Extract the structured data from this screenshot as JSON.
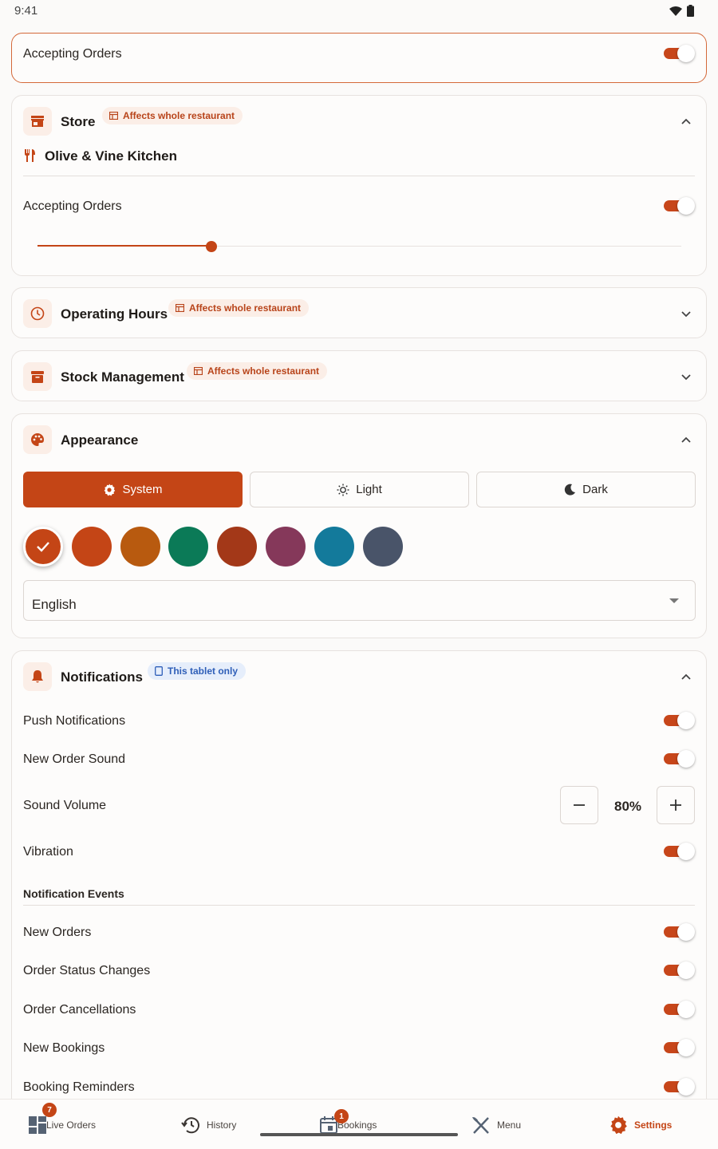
{
  "status_bar": {
    "time": "9:41",
    "wifi_icon": "wifi-icon",
    "battery_icon": "battery-icon"
  },
  "top_toggle": {
    "label": "Accepting Orders",
    "on": true
  },
  "store": {
    "title": "Store",
    "badge": "Affects whole restaurant",
    "restaurant_name": "Olive & Vine Kitchen",
    "accepting_label": "Accepting Orders",
    "accepting_on": true,
    "slider_value": 0.27,
    "expanded": true
  },
  "operating_hours": {
    "title": "Operating Hours",
    "badge": "Affects whole restaurant",
    "expanded": false
  },
  "stock": {
    "title": "Stock Management",
    "badge": "Affects whole restaurant",
    "expanded": false
  },
  "appearance": {
    "title": "Appearance",
    "expanded": true,
    "themes": [
      {
        "label": "System",
        "active": true
      },
      {
        "label": "Light",
        "active": false
      },
      {
        "label": "Dark",
        "active": false
      }
    ],
    "swatches": [
      "#c44516",
      "#c44516",
      "#b85a0f",
      "#0b7a57",
      "#a33818",
      "#85385a",
      "#137a9b",
      "#495469"
    ],
    "selected_swatch": 0,
    "language": "English"
  },
  "notifications": {
    "title": "Notifications",
    "badge": "This tablet only",
    "expanded": true,
    "push_label": "Push Notifications",
    "sound_label": "New Order Sound",
    "volume_label": "Sound Volume",
    "volume_value": "80%",
    "vibration_label": "Vibration",
    "events_heading": "Notification Events",
    "events": [
      {
        "label": "New Orders",
        "on": true
      },
      {
        "label": "Order Status Changes",
        "on": true
      },
      {
        "label": "Order Cancellations",
        "on": true
      },
      {
        "label": "New Bookings",
        "on": true
      },
      {
        "label": "Booking Reminders",
        "on": true
      }
    ]
  },
  "bottom_nav": {
    "items": [
      {
        "label": "Live Orders",
        "badge": "7"
      },
      {
        "label": "History"
      },
      {
        "label": "Bookings",
        "badge": "1"
      },
      {
        "label": "Menu"
      },
      {
        "label": "Settings",
        "active": true
      }
    ]
  },
  "colors": {
    "accent": "#c44516",
    "badge_bg": "#fbeee7",
    "blue_badge": "#2f5fb8"
  }
}
